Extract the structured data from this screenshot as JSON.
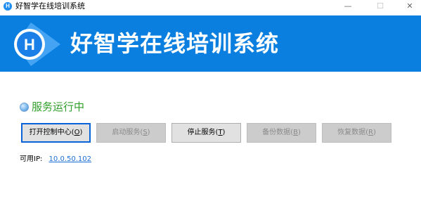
{
  "window": {
    "title": "好智学在线培训系统"
  },
  "titlebar": {
    "icon_letter": "H",
    "minimize": "—",
    "maximize": "☐",
    "close": "✕"
  },
  "banner": {
    "title": "好智学在线培训系统",
    "logo_letter": "H",
    "color": "#0a7fe0"
  },
  "status": {
    "text": "服务运行中",
    "color": "#2f9f2a"
  },
  "buttons": [
    {
      "label": "打开控制中心(",
      "key": "O",
      "suffix": ")",
      "enabled": true,
      "focused": true
    },
    {
      "label": "启动服务(",
      "key": "S",
      "suffix": ")",
      "enabled": false
    },
    {
      "label": "停止服务(",
      "key": "T",
      "suffix": ")",
      "enabled": true
    },
    {
      "label": "备份数据(",
      "key": "B",
      "suffix": ")",
      "enabled": false
    },
    {
      "label": "恢复数据(",
      "key": "R",
      "suffix": ")",
      "enabled": false
    }
  ],
  "ip": {
    "label": "可用IP:",
    "value": "10.0.50.102"
  }
}
